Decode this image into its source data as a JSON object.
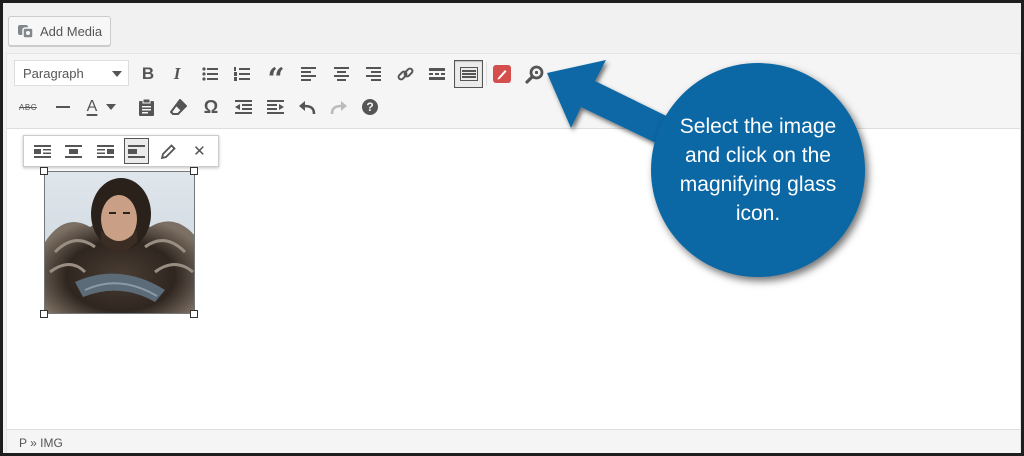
{
  "toolbar_top": {
    "add_media_label": "Add Media"
  },
  "editor": {
    "format_select": {
      "selected": "Paragraph"
    },
    "row1": [
      "bold",
      "italic",
      "bulleted-list",
      "numbered-list",
      "blockquote",
      "align-left",
      "align-center",
      "align-right",
      "insert-link",
      "read-more",
      "toolbar-toggle",
      "red-pen",
      "magnifier"
    ],
    "row2": [
      "strikethrough",
      "horizontal-line",
      "text-color",
      "paste-as-text",
      "clear-formatting",
      "special-character",
      "decrease-indent",
      "increase-indent",
      "undo",
      "redo",
      "help"
    ],
    "image_toolbar": [
      "align-left",
      "align-center",
      "align-right",
      "align-none",
      "edit",
      "remove"
    ],
    "status_path": "P » IMG"
  },
  "annotation": {
    "text": "Select the image and click on the magnifying glass icon.",
    "color": "#0b68a5"
  },
  "icons": {
    "bold_glyph": "B",
    "italic_glyph": "I",
    "quote_glyph": "“",
    "omega_glyph": "Ω",
    "help_glyph": "?",
    "strike_glyph": "ABC",
    "text_color_glyph": "A",
    "close_glyph": "✕"
  }
}
